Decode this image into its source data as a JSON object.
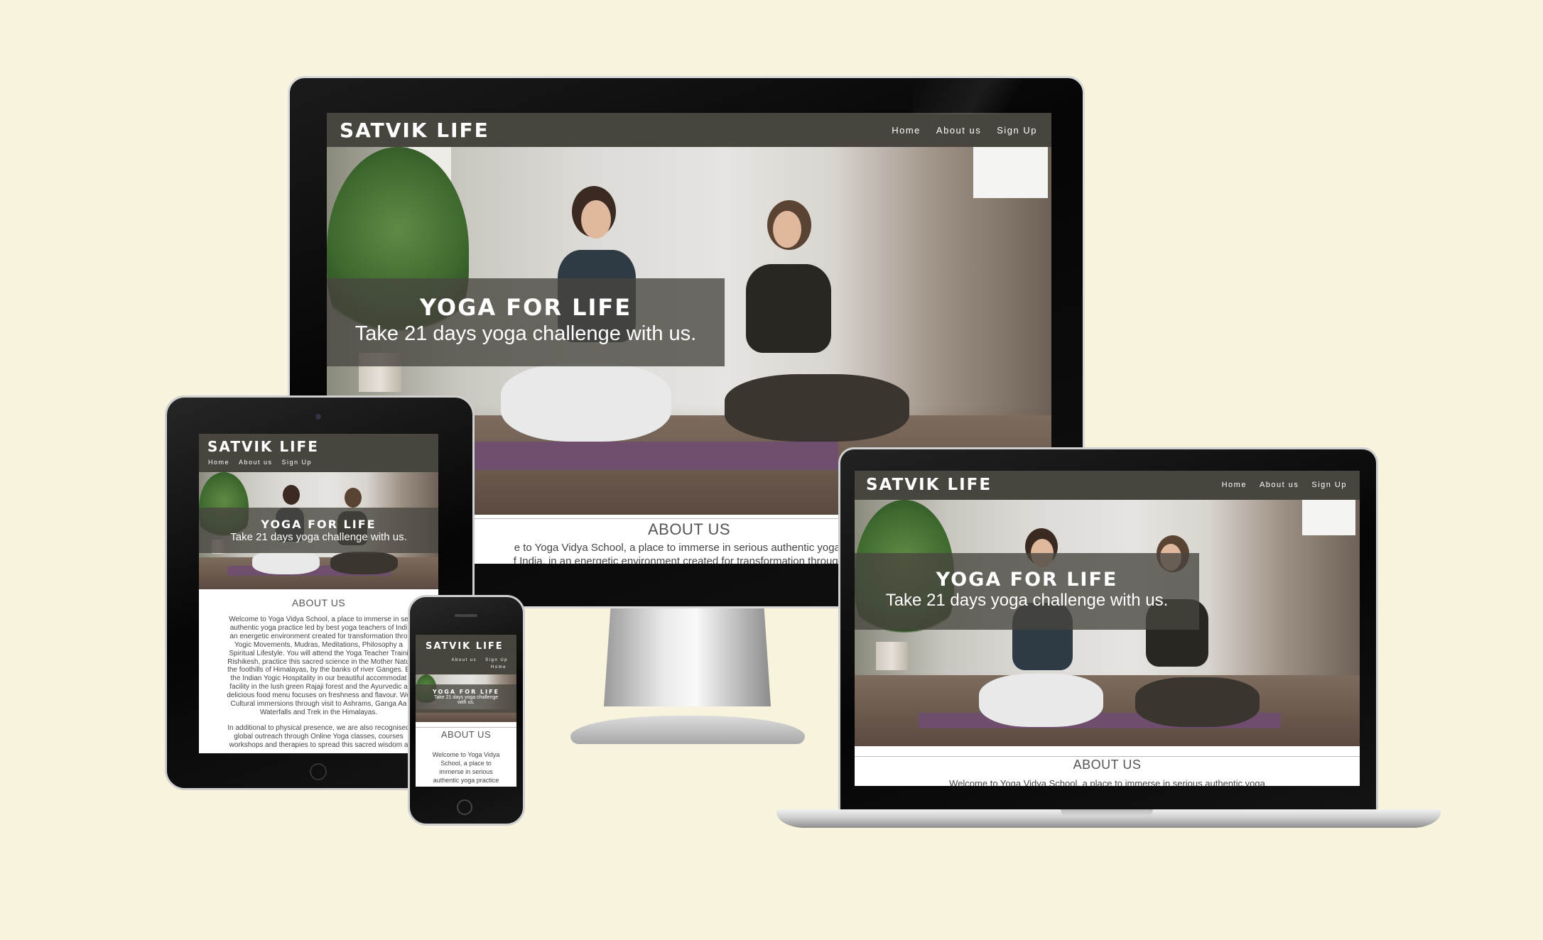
{
  "site": {
    "brand": "SATVIK LIFE",
    "nav": [
      "Home",
      "About us",
      "Sign Up"
    ],
    "hero_title": "YOGA FOR LIFE",
    "hero_subtitle": "Take 21 days yoga challenge with us.",
    "about_heading": "ABOUT US",
    "desktop_about_line1": "e to Yoga Vidya School, a place to immerse in serious authentic yoga prac",
    "desktop_about_line2": "f India, in an energetic environment created for transformation through Yog",
    "laptop_about_line1": "Welcome to Yoga Vidya School, a place to immerse in serious authentic yoga",
    "tablet_about_lines": [
      "Welcome to Yoga Vidya School, a place to immerse in se",
      "authentic yoga practice led by best yoga teachers of Indi",
      "an energetic environment created for transformation thro",
      "Yogic Movements, Mudras, Meditations, Philosophy a",
      "Spiritual Lifestyle. You will attend the Yoga Teacher Traini",
      "Rishikesh, practice this sacred science in the Mother Natu",
      "the foothills of Himalayas, by the banks of river Ganges. E",
      "the Indian Yogic Hospitality in our beautiful accommodat",
      "facility in the lush green Rajaji forest and the Ayurvedic a",
      "delicious food menu focuses on freshness and flavour. We",
      "Cultural immersions through visit to Ashrams, Ganga Aa",
      "Waterfalls and Trek in the Himalayas."
    ],
    "tablet_about_lines2": [
      "In additional to physical presence, we are also recognised",
      "global outreach through Online Yoga classes, courses",
      "workshops and therapies to spread this sacred wisdom a"
    ],
    "phone_nav_line1": [
      "About us",
      "Sign Up"
    ],
    "phone_nav_line2": "Home",
    "phone_hero_subtitle_lines": [
      "Take 21 days yoga challenge",
      "with us."
    ],
    "phone_about_lines": [
      "Welcome to Yoga Vidya",
      "School, a place to",
      "immerse in serious",
      "authentic yoga practice"
    ]
  }
}
